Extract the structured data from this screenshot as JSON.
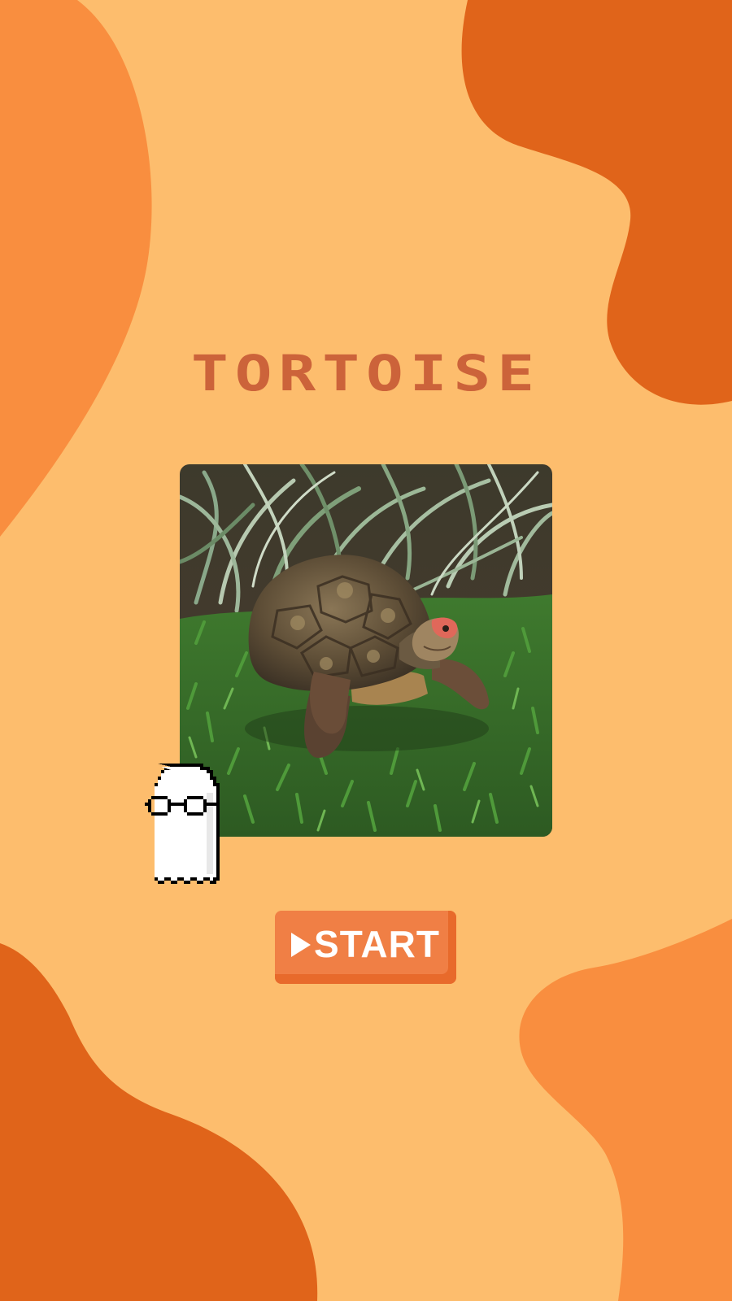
{
  "screen": {
    "title": "TORTOISE",
    "start_button": {
      "label": "START",
      "icon": "play-icon"
    },
    "photo": {
      "subject": "tortoise"
    },
    "mascot": {
      "icon": "ghost-with-glasses-icon"
    }
  },
  "colors": {
    "background": "#fdbd6d",
    "blob_light": "#f98e3f",
    "blob_dark": "#e0641a",
    "title": "#cc633a",
    "button": "#f07f45",
    "button_shade": "#e86a2b",
    "button_text": "#ffffff"
  }
}
